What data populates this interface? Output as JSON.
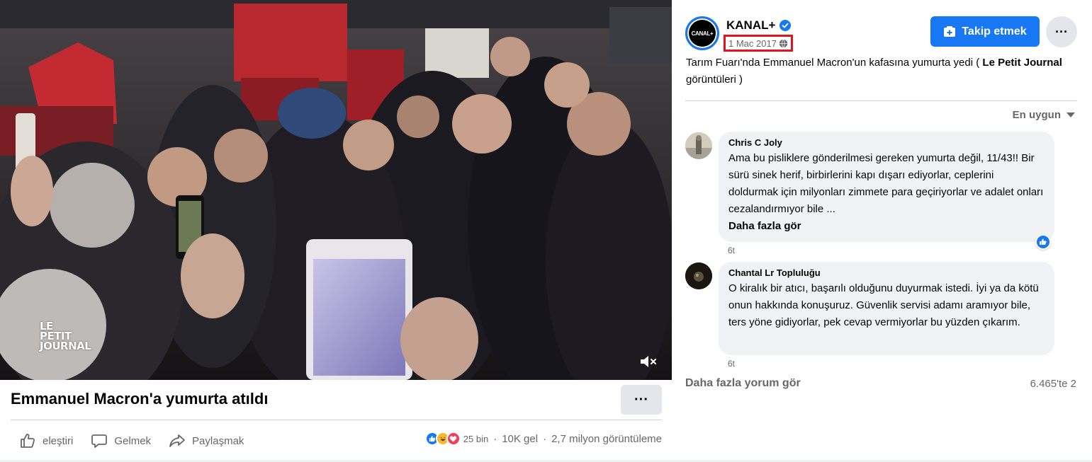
{
  "video": {
    "watermark": [
      "LE",
      "PETIT",
      "JOURNAL"
    ],
    "title": "Emmanuel Macron'a yumurta atıldı"
  },
  "actions": {
    "like_label": "eleştiri",
    "comment_label": "Gelmek",
    "share_label": "Paylaşmak"
  },
  "stats": {
    "reactions": "25 bin",
    "comments": "10K gel",
    "views": "2,7 milyon görüntüleme",
    "separator": "·"
  },
  "post": {
    "page_name": "KANAL+",
    "avatar_text": "CANAL+",
    "date": "1 Mac 2017",
    "follow_label": "Takip etmek",
    "more_label": "···",
    "caption_plain": "Tarım Fuarı'nda Emmanuel Macron'un kafasına yumurta yedi ( ",
    "caption_bold": "Le Petit Journal",
    "caption_end": " görüntüleri )"
  },
  "comments": {
    "sort_label": "En uygun",
    "items": [
      {
        "author": "Chris C Joly",
        "text": "Ama bu pisliklere gönderilmesi gereken yumurta değil, 11/43!! Bir sürü sinek herif, birbirlerini kapı dışarı ediyorlar, ceplerini doldurmak için milyonları zimmete para geçiriyorlar ve adalet onları cezalandırmıyor bile ...",
        "see_more": "Daha fazla gör",
        "time": "6t"
      },
      {
        "author": "Chantal Lr Topluluğu",
        "text": "O kiralık bir atıcı, başarılı olduğunu duyurmak istedi. İyi ya da kötü onun hakkında konuşuruz. Güvenlik servisi adamı aramıyor bile, ters yöne gidiyorlar, pek cevap vermiyorlar bu yüzden çıkarım.",
        "time": "6t"
      }
    ],
    "view_more_label": "Daha fazla yorum gör",
    "count_label": "6.465'te 2"
  },
  "colors": {
    "accent": "#1877f2",
    "highlight_box": "#e0141e",
    "secondary_text": "#65676b",
    "bubble": "#f0f2f5"
  }
}
